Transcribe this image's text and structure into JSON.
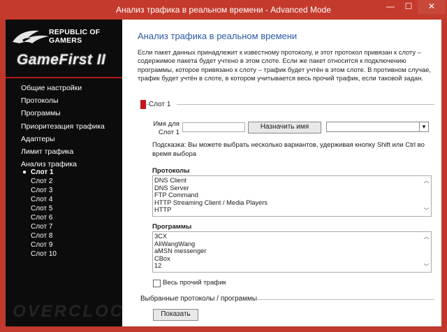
{
  "window": {
    "title": "Анализ трафика в реальном времени - Advanced Mode",
    "minimize": "—",
    "maximize": "☐",
    "close": "✕"
  },
  "brand": {
    "line1": "REPUBLIC OF",
    "line2": "GAMERS",
    "product": "GameFirst II"
  },
  "nav": {
    "items": [
      "Общие настройки",
      "Протоколы",
      "Программы",
      "Приоритезация трафика",
      "Адаптеры",
      "Лимит трафика",
      "Анализ трафика"
    ],
    "slot_bullet": "●",
    "slots": [
      "Слот 1",
      "Слот 2",
      "Слот 3",
      "Слот 4",
      "Слот 5",
      "Слот 6",
      "Слот 7",
      "Слот 8",
      "Слот 9",
      "Слот 10"
    ],
    "active_slot": "Слот 1"
  },
  "watermark": "OVERCLOCKERS.UA",
  "main": {
    "heading": "Анализ трафика в реальном времени",
    "description": "Если пакет данных принадлежит к известному протоколу, и этот протокол привязан к слоту – содержимое пакета будет учтено в этом слоте. Если же пакет относится к подключению программы, которое привязано к слоту – трафик будет учтён в этом слоте. В противном случае, трафик будет учтён в слоте, в котором учитывается весь прочий трафик, если таковой задан.",
    "slot_title": "Слот 1",
    "name_label": "Имя для Слот 1",
    "name_value": "",
    "assign_button": "Назначить имя",
    "select_value": "",
    "hint": "Подсказка: Вы можете выбрать несколько вариантов, удерживая кнопку Shift или Ctrl во время выбора",
    "protocols_title": "Протоколы",
    "protocols": [
      "DNS Client",
      "DNS Server",
      "FTP Command",
      "HTTP Streaming Client / Media Players",
      "HTTP"
    ],
    "programs_title": "Программы",
    "programs": [
      "3CX",
      "AliWangWang",
      "aMSN messenger",
      "CBox",
      "12"
    ],
    "other_traffic_label": "Весь прочий трафик",
    "selected_title": "Выбранные протоколы / программы",
    "show_button": "Показать"
  },
  "colors": {
    "accent_red": "#c4161c",
    "titlebar": "#c43a2c",
    "heading_blue": "#2a59a6"
  },
  "icons": {
    "scroll_up": "︿",
    "scroll_down": "﹀",
    "select_arrow": "▼"
  }
}
